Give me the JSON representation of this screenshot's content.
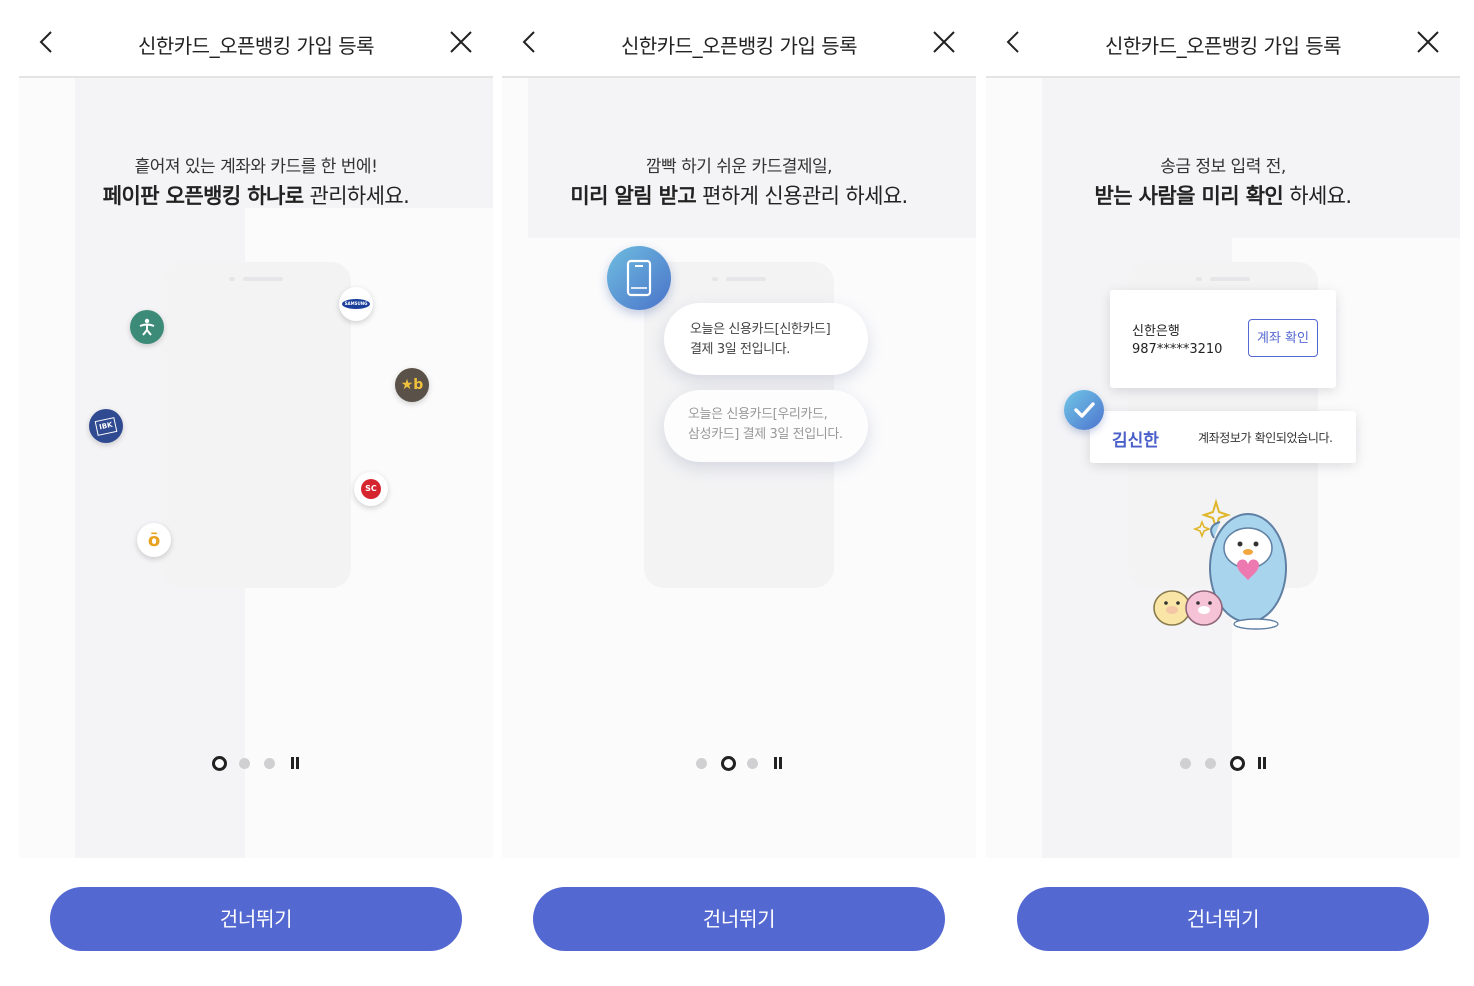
{
  "header": {
    "title": "신한카드_오픈뱅킹 가입 등록",
    "back_icon": "chevron-left-icon",
    "close_icon": "close-icon"
  },
  "screens": [
    {
      "line1": "흩어져 있는 계좌와 카드를 한 번에!",
      "line2_bold": "페이판 오픈뱅킹 하나로",
      "line2_rest": " 관리하세요.",
      "bank_icons": [
        {
          "name": "bank-green-icon",
          "label": "",
          "color": "#3c8b79"
        },
        {
          "name": "samsung-icon",
          "label": "SAMSUNG",
          "color": "#1a3f9a"
        },
        {
          "name": "kb-icon",
          "label": "★b",
          "color": "#5a5148"
        },
        {
          "name": "ibk-icon",
          "label": "IBK",
          "color": "#2f4a91"
        },
        {
          "name": "sc-icon",
          "label": "SC",
          "color": "#d5262f"
        },
        {
          "name": "hana-icon",
          "label": "ō",
          "color": "#e8a21f"
        }
      ],
      "page_indicator": {
        "current": 1,
        "total": 3
      }
    },
    {
      "line1": "깜빡 하기 쉬운 카드결제일,",
      "line2_bold": "미리 알림 받고",
      "line2_rest": " 편하게 신용관리 하세요.",
      "bubble1": [
        "오늘은 신용카드[신한카드]",
        "결제 3일 전입니다."
      ],
      "bubble2": [
        "오늘은 신용카드[우리카드,",
        "삼성카드] 결제 3일 전입니다."
      ],
      "page_indicator": {
        "current": 2,
        "total": 3
      }
    },
    {
      "line1": "송금 정보 입력 전,",
      "line2_bold": "받는 사람을 미리 확인",
      "line2_rest": " 하세요.",
      "bank_name": "신한은행",
      "account_number": "987*****3210",
      "verify_button": "계좌 확인",
      "recipient_name": "김신한",
      "confirm_message": "계좌정보가 확인되었습니다.",
      "page_indicator": {
        "current": 3,
        "total": 3
      }
    }
  ],
  "skip_button": "건너뛰기",
  "colors": {
    "primary": "#5468d2",
    "text_dark": "#222222",
    "accent_name": "#4a5fc9"
  }
}
